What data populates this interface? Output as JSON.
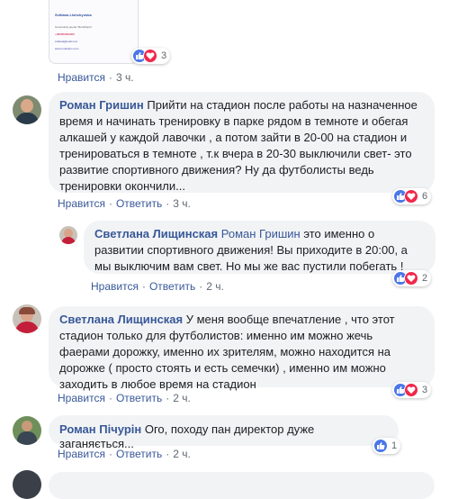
{
  "image_post": {
    "card_name": "Svitlana Lishchynska",
    "card_line1": "Community sports \"RunDnipro\"",
    "card_phone": "+380950000000",
    "card_email": "svitlana@mail.com",
    "card_extra": "www.rundnipro.com",
    "actions": {
      "like": "Нравится",
      "time": "3 ч."
    },
    "reactions_count": "3"
  },
  "comments": [
    {
      "author": "Роман Гришин",
      "text": "Прийти на стадион после работы на назначенное время и начинать тренировку в парке рядом в темноте и обегая алкашей у каждой лавочки , а потом зайти в 20-00 на стадион и тренироваться в темноте , т.к вчера в 20-30 выключили свет- это развитие спортивного движения? Ну да футболисты ведь тренировки окончили...",
      "reactions_count": "6",
      "actions": {
        "like": "Нравится",
        "reply": "Ответить",
        "time": "3 ч."
      }
    },
    {
      "author": "Светлана Лищинская",
      "reply_to": "Роман Гришин",
      "text": "это именно о развитии спортивного движения! Вы приходите в 20:00, а мы выключим вам свет. Но мы же вас пустили побегать !",
      "reactions_count": "2",
      "actions": {
        "like": "Нравится",
        "reply": "Ответить",
        "time": "2 ч."
      }
    },
    {
      "author": "Светлана Лищинская",
      "text": "У меня вообще впечатление , что этот стадион только для футболистов: именно им можно жечь фаерами дорожку, именно их зрителям, можно находится на дорожке ( просто стоять и есть семечки) , именно им можно заходить в любое время на стадион",
      "reactions_count": "3",
      "actions": {
        "like": "Нравится",
        "reply": "Ответить",
        "time": "2 ч."
      }
    },
    {
      "author": "Роман Пічурін",
      "text": "Ого, походу пан директор дуже заганяється...",
      "reactions_count": "1",
      "actions": {
        "like": "Нравится",
        "reply": "Ответить",
        "time": "2 ч."
      }
    }
  ],
  "colors": {
    "link": "#385898",
    "bubble": "#f2f3f5",
    "like": "#4a76e8",
    "love": "#f0284a"
  }
}
